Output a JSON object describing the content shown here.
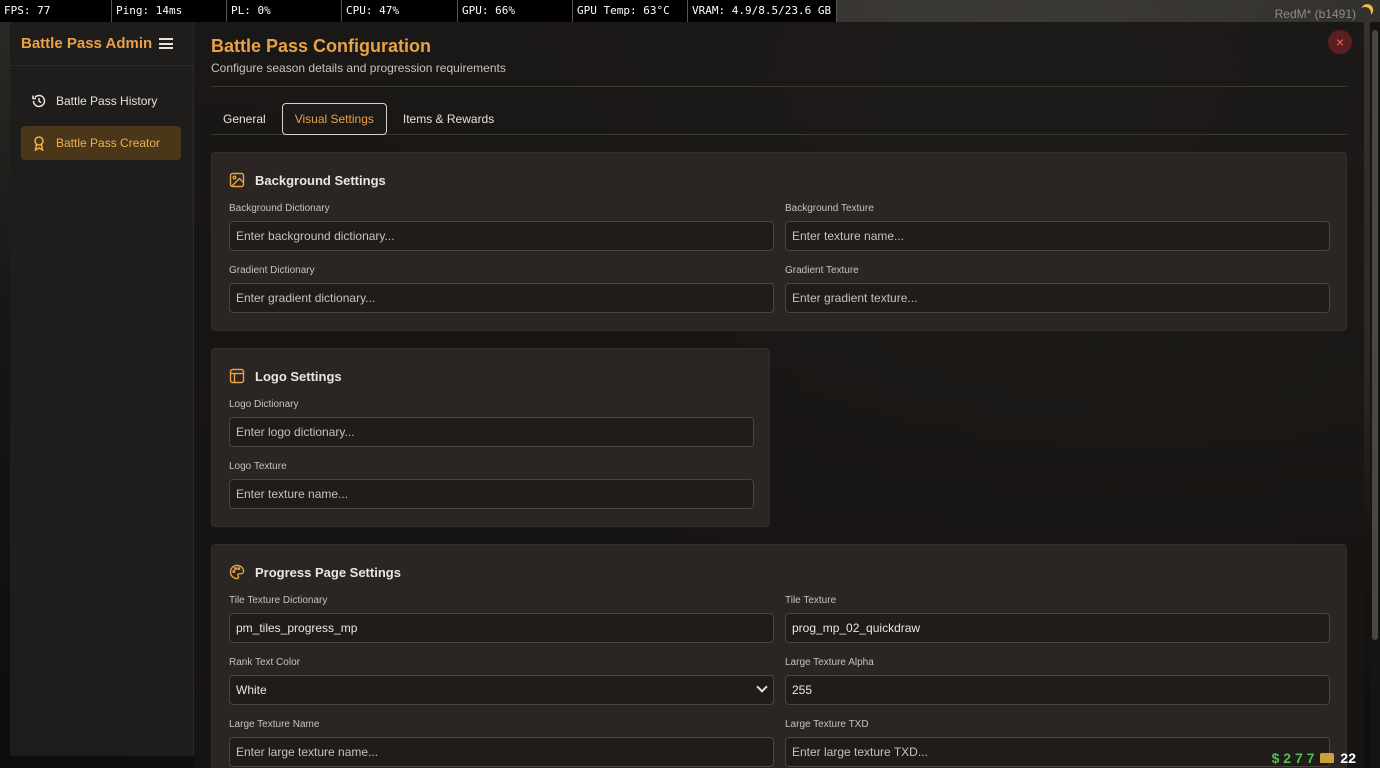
{
  "overlay": {
    "fps": "FPS: 77",
    "ping": "Ping: 14ms",
    "pl": "PL: 0%",
    "cpu": "CPU: 47%",
    "gpu": "GPU: 66%",
    "gpu_temp": "GPU Temp: 63°C",
    "vram": "VRAM: 4.9/8.5/23.6 GB",
    "client": "RedM* (b1491)",
    "hud_cash": "$ 2 7 7",
    "hud_gold": "22"
  },
  "sidebar": {
    "title": "Battle Pass Admin",
    "items": [
      {
        "label": "Battle Pass History",
        "icon": "history-icon",
        "active": false
      },
      {
        "label": "Battle Pass Creator",
        "icon": "award-icon",
        "active": true
      }
    ]
  },
  "header": {
    "title": "Battle Pass Configuration",
    "subtitle": "Configure season details and progression requirements",
    "close_label": "×"
  },
  "tabs": [
    {
      "label": "General",
      "active": false
    },
    {
      "label": "Visual Settings",
      "active": true
    },
    {
      "label": "Items & Rewards",
      "active": false
    }
  ],
  "background_settings": {
    "title": "Background Settings",
    "bg_dict_label": "Background Dictionary",
    "bg_dict_placeholder": "Enter background dictionary...",
    "bg_tex_label": "Background Texture",
    "bg_tex_placeholder": "Enter texture name...",
    "grad_dict_label": "Gradient Dictionary",
    "grad_dict_placeholder": "Enter gradient dictionary...",
    "grad_tex_label": "Gradient Texture",
    "grad_tex_placeholder": "Enter gradient texture..."
  },
  "logo_settings": {
    "title": "Logo Settings",
    "dict_label": "Logo Dictionary",
    "dict_placeholder": "Enter logo dictionary...",
    "tex_label": "Logo Texture",
    "tex_placeholder": "Enter texture name..."
  },
  "progress_settings": {
    "title": "Progress Page Settings",
    "tile_dict_label": "Tile Texture Dictionary",
    "tile_dict_value": "pm_tiles_progress_mp",
    "tile_tex_label": "Tile Texture",
    "tile_tex_value": "prog_mp_02_quickdraw",
    "rank_color_label": "Rank Text Color",
    "rank_color_value": "White",
    "alpha_label": "Large Texture Alpha",
    "alpha_value": "255",
    "large_name_label": "Large Texture Name",
    "large_name_placeholder": "Enter large texture name...",
    "large_txd_label": "Large Texture TXD",
    "large_txd_placeholder": "Enter large texture TXD..."
  },
  "colors": {
    "accent": "#e8a245",
    "active_bg": "#4a3618",
    "card_bg": "#2b2623",
    "close_bg": "#5a1f1f"
  }
}
